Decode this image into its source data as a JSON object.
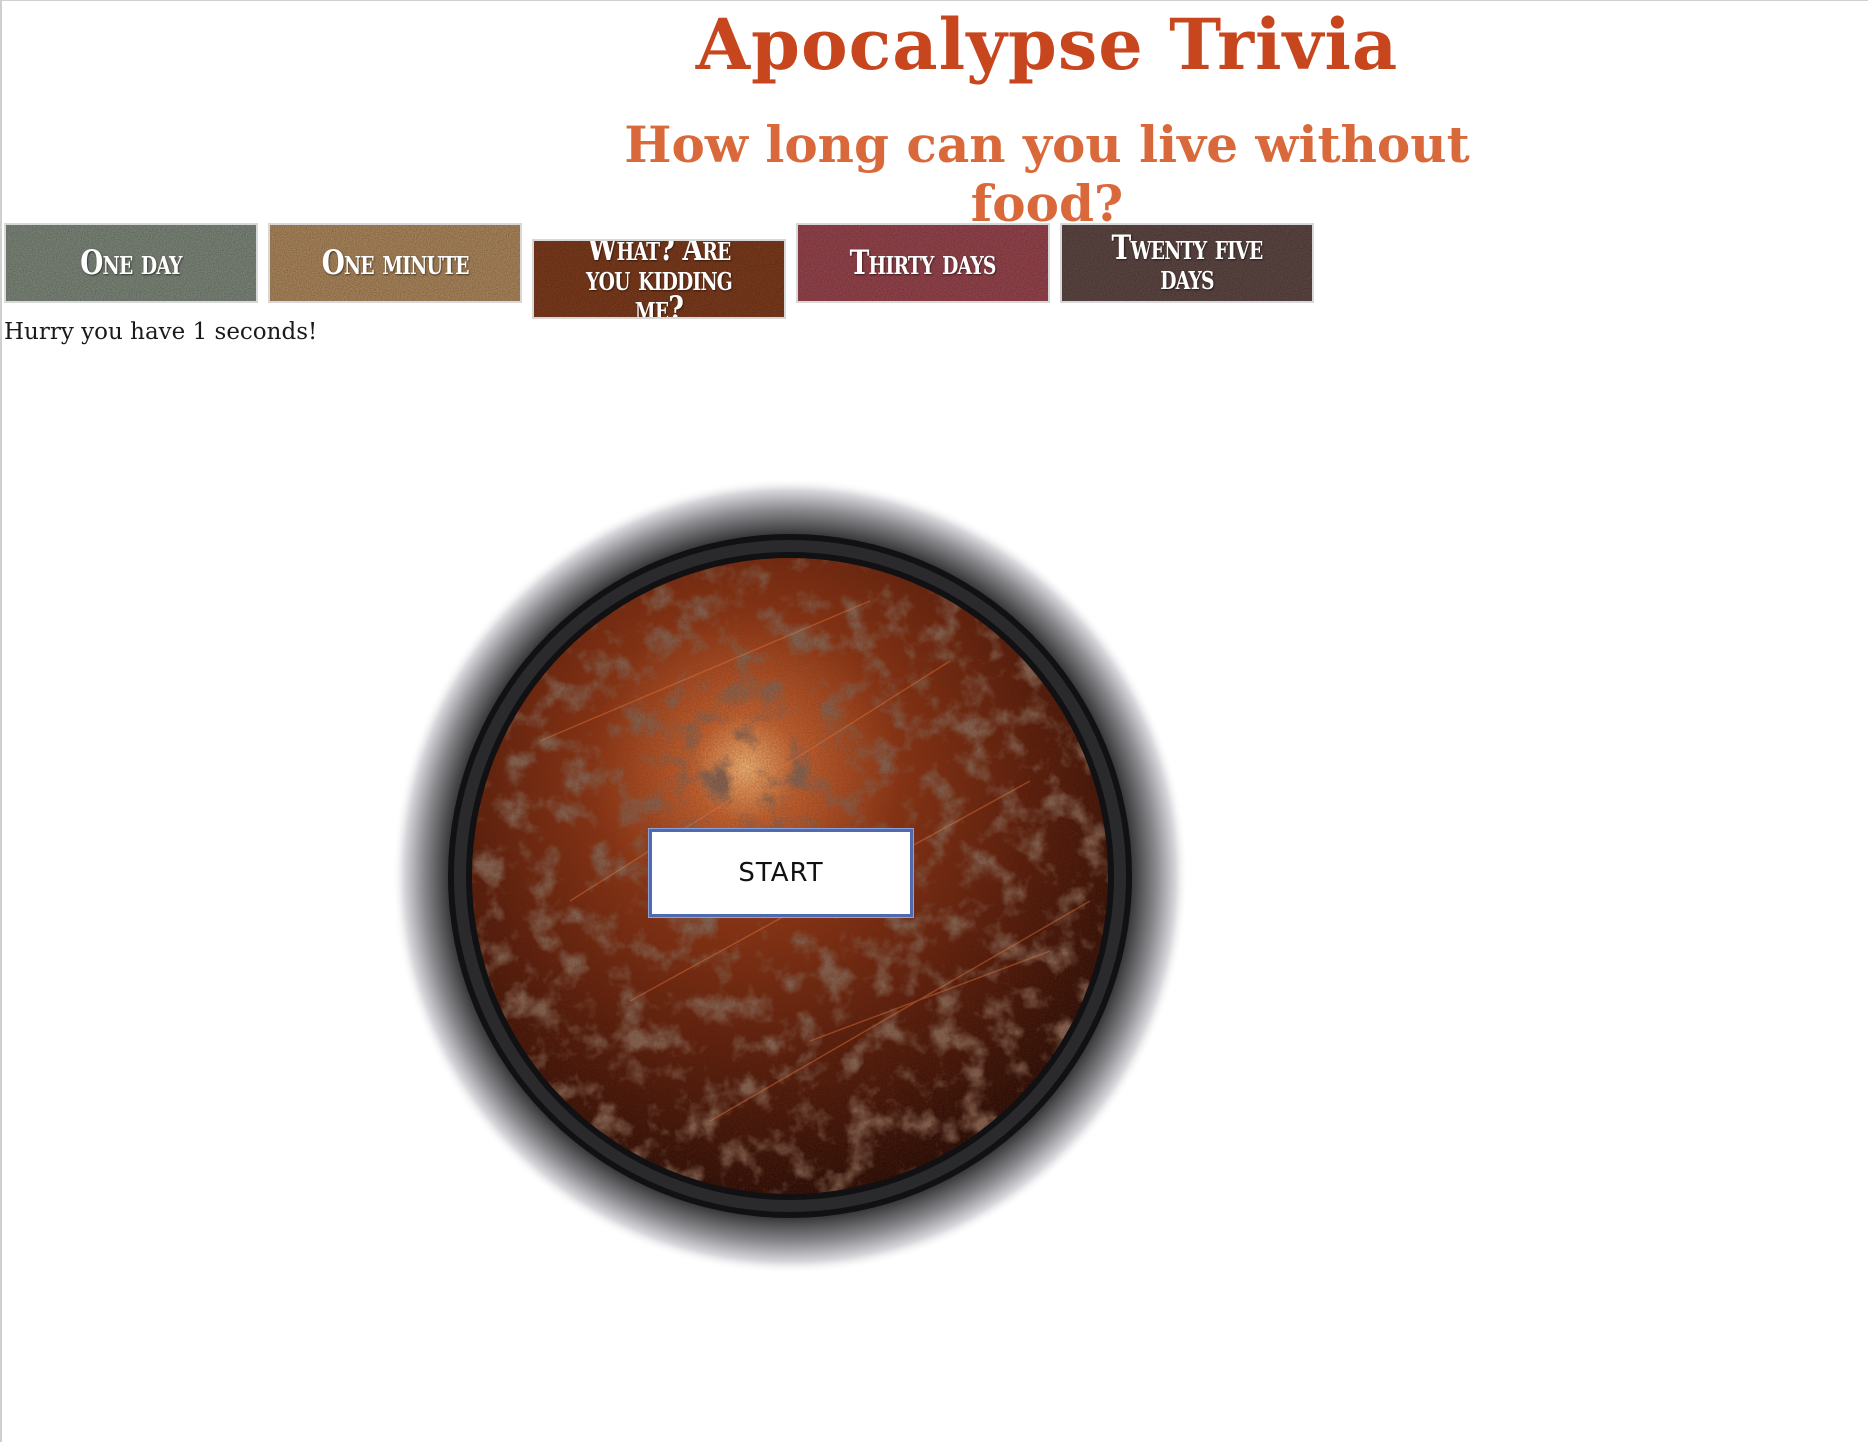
{
  "header": {
    "title": "Apocalypse Trivia",
    "question": "How long can you live without food?"
  },
  "colors": {
    "title": "#c8461e",
    "question": "#d9693a"
  },
  "answers": [
    {
      "label": "One day",
      "color": "#7b8478"
    },
    {
      "label": "One minute",
      "color": "#a9845a"
    },
    {
      "label": "What? Are you kidding me?",
      "color": "#7a3a1c"
    },
    {
      "label": "Thirty days",
      "color": "#94434b"
    },
    {
      "label": "Twenty five days",
      "color": "#5b4541"
    }
  ],
  "timer": {
    "text": "Hurry you have 1 seconds!"
  },
  "start": {
    "label": "START"
  }
}
